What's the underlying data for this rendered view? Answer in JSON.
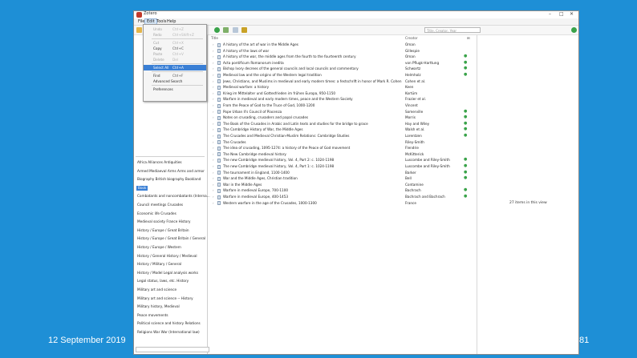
{
  "slide": {
    "date": "12 September 2019",
    "page": "81"
  },
  "window": {
    "title": "Zotero"
  },
  "menubar": [
    "File",
    "Edit",
    "Tools",
    "Help"
  ],
  "search": {
    "placeholder": "Title, Creator, Year"
  },
  "edit_menu": [
    {
      "label": "Undo",
      "shortcut": "Ctrl+Z",
      "enabled": false
    },
    {
      "label": "Redo",
      "shortcut": "Ctrl+Shift+Z",
      "enabled": false
    },
    {
      "sep": true
    },
    {
      "label": "Cut",
      "shortcut": "Ctrl+X",
      "enabled": false
    },
    {
      "label": "Copy",
      "shortcut": "Ctrl+C",
      "enabled": true
    },
    {
      "label": "Paste",
      "shortcut": "Ctrl+V",
      "enabled": false
    },
    {
      "label": "Delete",
      "shortcut": "Del",
      "enabled": false
    },
    {
      "sep": true
    },
    {
      "label": "Select All",
      "shortcut": "Ctrl+A",
      "enabled": true,
      "highlighted": true
    },
    {
      "sep": true
    },
    {
      "label": "Find",
      "shortcut": "Ctrl+F",
      "enabled": true
    },
    {
      "label": "Advanced Search",
      "shortcut": "",
      "enabled": true
    },
    {
      "sep": true
    },
    {
      "label": "Preferences",
      "shortcut": "",
      "enabled": true
    }
  ],
  "columns": {
    "title": "Title",
    "creator": "Creator"
  },
  "items": [
    {
      "title": "A history of the art of war in the Middle Ages",
      "creator": "Oman",
      "att": false
    },
    {
      "title": "A history of the laws of war",
      "creator": "Gillespie",
      "att": false
    },
    {
      "title": "A history of the war, the middle ages from the fourth to the fourteenth century",
      "creator": "Oman",
      "att": true
    },
    {
      "title": "Acta pontificum Romanorum inedita",
      "creator": "von Pflugk-Harttung",
      "att": true
    },
    {
      "title": "Bishop Ivory decrees of the general councils and local councils and commentary",
      "creator": "Schwartz",
      "att": true
    },
    {
      "title": "Medieval law and the origins of the Western legal tradition",
      "creator": "Helmholz",
      "att": true
    },
    {
      "title": "Jews, Christians, and Muslims in medieval and early modern times: a festschrift in honor of Mark R. Cohen",
      "creator": "Cohen et al.",
      "att": false
    },
    {
      "title": "Medieval warfare: a history",
      "creator": "Keen",
      "att": false
    },
    {
      "title": "Krieg im Mittelalter und Gottesfrieden im frühen Europa, 950-1150",
      "creator": "Kortüm",
      "att": false
    },
    {
      "title": "Warfare in medieval and early modern times, peace and the Western Society",
      "creator": "Frazier et al.",
      "att": false
    },
    {
      "title": "From the Peace of God to the Truce of God, 1000-1200",
      "creator": "Vincent",
      "att": false
    },
    {
      "title": "Pope Urban II's Council of Piacenza",
      "creator": "Somerville",
      "att": true
    },
    {
      "title": "Notes on crusading, crusaders and papal crusades",
      "creator": "Morris",
      "att": true
    },
    {
      "title": "The Book of the Crusades in Arabic and Latin texts and studies for the bridge to grace",
      "creator": "Hay and Wiley",
      "att": true
    },
    {
      "title": "The Cambridge History of War, the Middle Ages",
      "creator": "Walsh et al.",
      "att": true
    },
    {
      "title": "The Crusades and Medieval Christian-Muslim Relations: Cambridge Studies",
      "creator": "Lorentzen",
      "att": true
    },
    {
      "title": "The Crusades",
      "creator": "Riley-Smith",
      "att": false
    },
    {
      "title": "The idea of crusading, 1095-1274: a history of the Peace of God movement",
      "creator": "Flendrie",
      "att": false
    },
    {
      "title": "The New Cambridge medieval history",
      "creator": "McKitterick",
      "att": false
    },
    {
      "title": "The new Cambridge medieval history, Vol. 4, Part 2: c. 1024-1198",
      "creator": "Luscombe and Riley-Smith",
      "att": true
    },
    {
      "title": "The new Cambridge medieval history, Vol. 4, Part 1: c. 1024-1198",
      "creator": "Luscombe and Riley-Smith",
      "att": true
    },
    {
      "title": "The tournament in England, 1100-1400",
      "creator": "Barker",
      "att": true
    },
    {
      "title": "War and the Middle Ages, Christian tradition",
      "creator": "Bell",
      "att": true
    },
    {
      "title": "War in the Middle Ages",
      "creator": "Contamine",
      "att": false
    },
    {
      "title": "Warfare in medieval Europe, 700-1100",
      "creator": "Bachrach",
      "att": true
    },
    {
      "title": "Warfare in medieval Europe, 400-1453",
      "creator": "Bachrach and Bachrach",
      "att": true
    },
    {
      "title": "Western warfare in the age of the Crusades, 1000-1300",
      "creator": "France",
      "att": false
    }
  ],
  "tags": [
    "Africa   Alliances   Antiquities",
    "Armed Mediaeval   Arms   Arms and armor",
    "Biography   British biography   Bookland",
    "Book",
    "Combatants and noncombatants (Interna...",
    "Council meetings   Crusades",
    "Economic life   Crusades",
    "Medieval society   France   History",
    "History / Europe / Great Britain",
    "History / Europe / Great Britain / General",
    "History / Europe / Western",
    "History / General   History / Medieval",
    "History / Military / General",
    "History / Model   Legal analysis   works",
    "Legal status, laws, etc.   History",
    "Military art and science",
    "Military art and science -- History",
    "Military history, Medieval",
    "Peace movements",
    "Political science and history   Relations",
    "Religions   War   War (International law)"
  ],
  "selected_tag_index": 3,
  "status": {
    "items_count": "27 items in this view"
  },
  "colors": {
    "background": "#1e8fd6",
    "selection": "#3a7fd5",
    "attachment": "#3aa34a"
  }
}
